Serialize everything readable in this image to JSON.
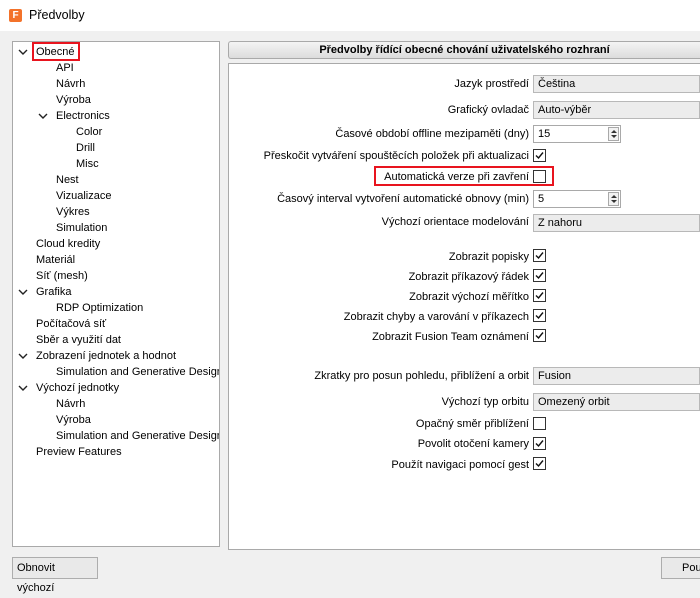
{
  "window": {
    "title": "Předvolby",
    "app_icon_letter": "F",
    "accent_color": "#f3722a"
  },
  "tree": {
    "items": [
      {
        "label": "Obecné",
        "expanded": true,
        "selected": true
      },
      {
        "label": "API"
      },
      {
        "label": "Návrh"
      },
      {
        "label": "Výroba"
      },
      {
        "label": "Electronics",
        "expanded": true
      },
      {
        "label": "Color"
      },
      {
        "label": "Drill"
      },
      {
        "label": "Misc"
      },
      {
        "label": "Nest"
      },
      {
        "label": "Vizualizace"
      },
      {
        "label": "Výkres"
      },
      {
        "label": "Simulation"
      },
      {
        "label": "Cloud kredity"
      },
      {
        "label": "Materiál"
      },
      {
        "label": "Síť (mesh)"
      },
      {
        "label": "Grafika",
        "expanded": true
      },
      {
        "label": "RDP Optimization"
      },
      {
        "label": "Počítačová síť"
      },
      {
        "label": "Sběr a využití dat"
      },
      {
        "label": "Zobrazení jednotek a hodnot",
        "expanded": true
      },
      {
        "label": "Simulation and Generative Design"
      },
      {
        "label": "Výchozí jednotky",
        "expanded": true
      },
      {
        "label": "Návrh"
      },
      {
        "label": "Výroba"
      },
      {
        "label": "Simulation and Generative Design"
      },
      {
        "label": "Preview Features"
      }
    ]
  },
  "content": {
    "header": "Předvolby řídící obecné chování uživatelského rozhraní",
    "language": {
      "label": "Jazyk prostředí",
      "value": "Čeština"
    },
    "graphics_driver": {
      "label": "Grafický ovladač",
      "value": "Auto-výběr"
    },
    "offline_cache": {
      "label": "Časové období offline mezipaměti (dny)",
      "value": "15"
    },
    "skip_launch_items": {
      "label": "Přeskočit vytváření spouštěcích položek při aktualizaci",
      "checked": true
    },
    "auto_version": {
      "label": "Automatická verze při zavření",
      "checked": false
    },
    "autosave_interval": {
      "label": "Časový interval vytvoření automatické obnovy (min)",
      "value": "5"
    },
    "model_orientation": {
      "label": "Výchozí orientace modelování",
      "value": "Z nahoru"
    },
    "show_tooltips": {
      "label": "Zobrazit popisky",
      "checked": true
    },
    "show_command_line": {
      "label": "Zobrazit příkazový řádek",
      "checked": true
    },
    "show_scale": {
      "label": "Zobrazit výchozí měřítko",
      "checked": true
    },
    "show_errors": {
      "label": "Zobrazit chyby a varování v příkazech",
      "checked": true
    },
    "show_team_notices": {
      "label": "Zobrazit Fusion Team oznámení",
      "checked": true
    },
    "pan_zoom_orbit": {
      "label": "Zkratky pro posun pohledu, přiblížení a orbit",
      "value": "Fusion"
    },
    "orbit_type": {
      "label": "Výchozí typ orbitu",
      "value": "Omezený orbit"
    },
    "reverse_zoom": {
      "label": "Opačný směr přiblížení",
      "checked": false
    },
    "camera_pivot": {
      "label": "Povolit otočení kamery",
      "checked": true
    },
    "gesture_nav": {
      "label": "Použít navigaci pomocí gest",
      "checked": true
    }
  },
  "buttons": {
    "restore_defaults": "Obnovit výchozí",
    "apply_partial": "Pou"
  },
  "highlight_color": "#e8141e"
}
